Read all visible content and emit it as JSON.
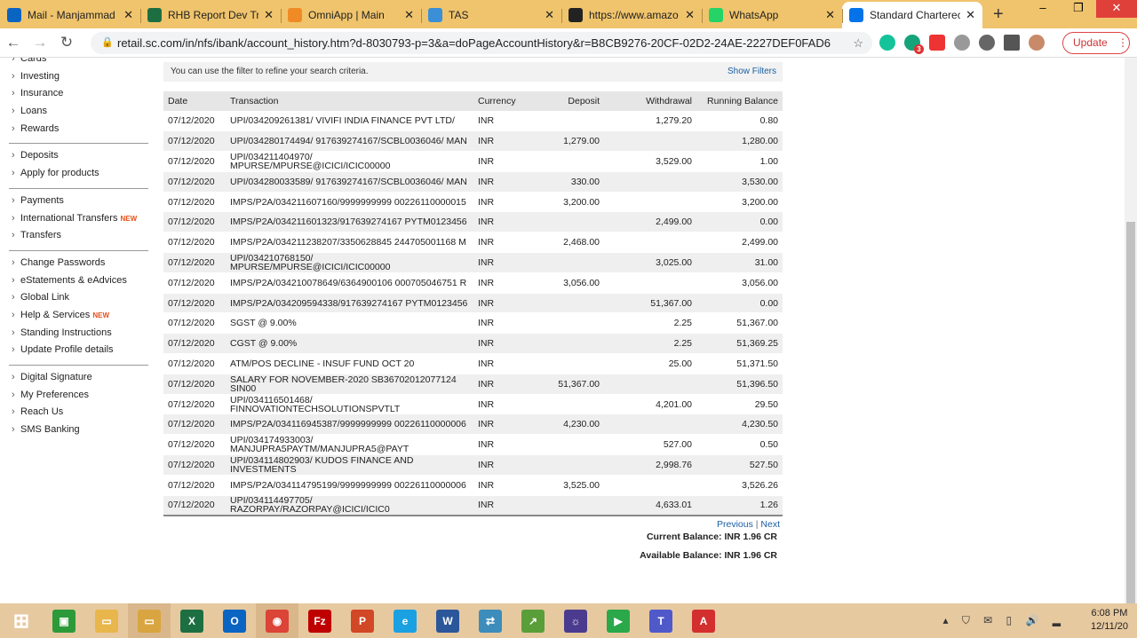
{
  "browser": {
    "tabs": [
      {
        "title": "Mail - Manjammad",
        "icon": "outlook-icon",
        "color": "#0a64c2"
      },
      {
        "title": "RHB Report Dev Tr",
        "icon": "excel-icon",
        "color": "#1d6f42"
      },
      {
        "title": "OmniApp | Main",
        "icon": "omniapp-icon",
        "color": "#f08a24"
      },
      {
        "title": "TAS",
        "icon": "tas-icon",
        "color": "#3a8fd6"
      },
      {
        "title": "https://www.amazo",
        "icon": "amazon-icon",
        "color": "#222222"
      },
      {
        "title": "WhatsApp",
        "icon": "whatsapp-icon",
        "color": "#25d366"
      },
      {
        "title": "Standard Charterec",
        "icon": "standard-chartered-icon",
        "color": "#0473ea"
      }
    ],
    "url": "retail.sc.com/in/nfs/ibank/account_history.htm?d-8030793-p=3&a=doPageAccountHistory&r=B8CB9276-20CF-02D2-24AE-2227DEF0FAD6",
    "update_label": "Update",
    "ext_badge": "3"
  },
  "sidebar": {
    "groups": [
      [
        "Cards",
        "Investing",
        "Insurance",
        "Loans",
        "Rewards"
      ],
      [
        "Deposits",
        "Apply for products"
      ],
      [
        "Payments",
        "International Transfers",
        "Transfers"
      ],
      [
        "Change Passwords",
        "eStatements & eAdvices",
        "Global Link",
        "Help & Services",
        "Standing Instructions",
        "Update Profile details"
      ],
      [
        "Digital Signature",
        "My Preferences",
        "Reach Us",
        "SMS Banking"
      ]
    ],
    "new_badge": "NEW"
  },
  "filter": {
    "hint": "You can use the filter to refine your search criteria.",
    "show_filters": "Show Filters"
  },
  "table": {
    "headers": [
      "Date",
      "Transaction",
      "Currency",
      "Deposit",
      "Withdrawal",
      "Running Balance"
    ],
    "rows": [
      [
        "07/12/2020",
        "UPI/034209261381/ VIVIFI INDIA FINANCE PVT LTD/",
        "INR",
        "",
        "1,279.20",
        "0.80"
      ],
      [
        "07/12/2020",
        "UPI/034280174494/ 917639274167/SCBL0036046/ MAN",
        "INR",
        "1,279.00",
        "",
        "1,280.00"
      ],
      [
        "07/12/2020",
        "UPI/034211404970/ MPURSE/MPURSE@ICICI/ICIC00000",
        "INR",
        "",
        "3,529.00",
        "1.00"
      ],
      [
        "07/12/2020",
        "UPI/034280033589/ 917639274167/SCBL0036046/ MAN",
        "INR",
        "330.00",
        "",
        "3,530.00"
      ],
      [
        "07/12/2020",
        "IMPS/P2A/034211607160/9999999999 00226110000015",
        "INR",
        "3,200.00",
        "",
        "3,200.00"
      ],
      [
        "07/12/2020",
        "IMPS/P2A/034211601323/917639274167 PYTM0123456",
        "INR",
        "",
        "2,499.00",
        "0.00"
      ],
      [
        "07/12/2020",
        "IMPS/P2A/034211238207/3350628845 244705001168 M",
        "INR",
        "2,468.00",
        "",
        "2,499.00"
      ],
      [
        "07/12/2020",
        "UPI/034210768150/ MPURSE/MPURSE@ICICI/ICIC00000",
        "INR",
        "",
        "3,025.00",
        "31.00"
      ],
      [
        "07/12/2020",
        "IMPS/P2A/034210078649/6364900106 000705046751 R",
        "INR",
        "3,056.00",
        "",
        "3,056.00"
      ],
      [
        "07/12/2020",
        "IMPS/P2A/034209594338/917639274167 PYTM0123456",
        "INR",
        "",
        "51,367.00",
        "0.00"
      ],
      [
        "07/12/2020",
        "SGST @ 9.00%",
        "INR",
        "",
        "2.25",
        "51,367.00"
      ],
      [
        "07/12/2020",
        "CGST @ 9.00%",
        "INR",
        "",
        "2.25",
        "51,369.25"
      ],
      [
        "07/12/2020",
        "ATM/POS DECLINE - INSUF FUND OCT 20",
        "INR",
        "",
        "25.00",
        "51,371.50"
      ],
      [
        "07/12/2020",
        "SALARY FOR NOVEMBER-2020 SB36702012077124 SIN00",
        "INR",
        "51,367.00",
        "",
        "51,396.50"
      ],
      [
        "07/12/2020",
        "UPI/034116501468/ FINNOVATIONTECHSOLUTIONSPVTLT",
        "INR",
        "",
        "4,201.00",
        "29.50"
      ],
      [
        "07/12/2020",
        "IMPS/P2A/034116945387/9999999999 00226110000006",
        "INR",
        "4,230.00",
        "",
        "4,230.50"
      ],
      [
        "07/12/2020",
        "UPI/034174933003/ MANJUPRA5PAYTM/MANJUPRA5@PAYT",
        "INR",
        "",
        "527.00",
        "0.50"
      ],
      [
        "07/12/2020",
        "UPI/034114802903/ KUDOS FINANCE AND INVESTMENTS",
        "INR",
        "",
        "2,998.76",
        "527.50"
      ],
      [
        "07/12/2020",
        "IMPS/P2A/034114795199/9999999999 00226110000006",
        "INR",
        "3,525.00",
        "",
        "3,526.26"
      ],
      [
        "07/12/2020",
        "UPI/034114497705/ RAZORPAY/RAZORPAY@ICICI/ICIC0",
        "INR",
        "",
        "4,633.01",
        "1.26"
      ]
    ]
  },
  "pager": {
    "previous": "Previous",
    "sep": " | ",
    "next": "Next"
  },
  "balances": {
    "current": "Current Balance: INR  1.96 CR",
    "available": "Available Balance: INR  1.96 CR"
  },
  "taskbar": {
    "apps": [
      {
        "name": "start",
        "color": "#0078d7",
        "label": "⊞"
      },
      {
        "name": "store",
        "color": "#2d9a3a",
        "label": "▣"
      },
      {
        "name": "file-explorer",
        "color": "#e8b64a",
        "label": "▭"
      },
      {
        "name": "file-explorer-2",
        "color": "#d9a540",
        "label": "▭"
      },
      {
        "name": "excel",
        "color": "#1d6f42",
        "label": "X"
      },
      {
        "name": "outlook",
        "color": "#0a64c2",
        "label": "O"
      },
      {
        "name": "chrome",
        "color": "#db4437",
        "label": "◉"
      },
      {
        "name": "filezilla",
        "color": "#bf0000",
        "label": "Fz"
      },
      {
        "name": "powerpoint",
        "color": "#d24726",
        "label": "P"
      },
      {
        "name": "internet-explorer",
        "color": "#1ba1e2",
        "label": "e"
      },
      {
        "name": "word",
        "color": "#2b579a",
        "label": "W"
      },
      {
        "name": "network-app",
        "color": "#3c8dbc",
        "label": "⇄"
      },
      {
        "name": "chart-app",
        "color": "#5a9e3a",
        "label": "↗"
      },
      {
        "name": "java-ee-ide",
        "color": "#4b3b8f",
        "label": "☼"
      },
      {
        "name": "media-app",
        "color": "#2aa84a",
        "label": "▶"
      },
      {
        "name": "teams",
        "color": "#5059c9",
        "label": "T"
      },
      {
        "name": "acrobat",
        "color": "#d32f2f",
        "label": "A"
      }
    ],
    "time": "6:08 PM",
    "date": "12/11/20"
  }
}
